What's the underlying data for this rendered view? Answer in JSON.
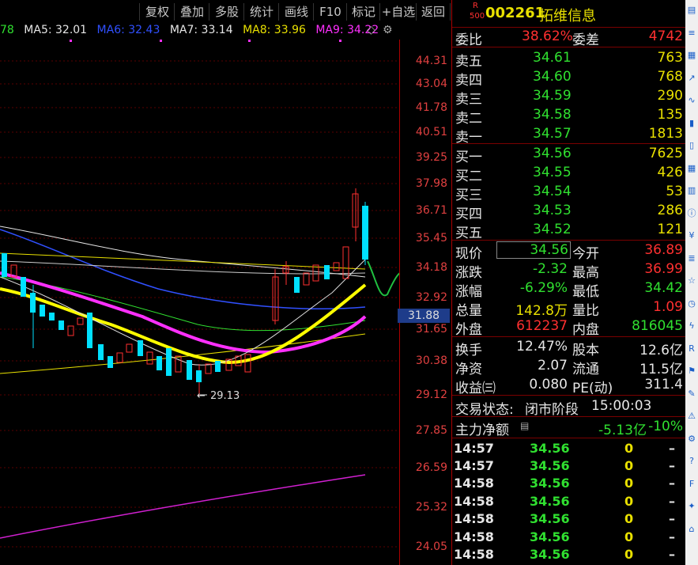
{
  "toolbar": {
    "buttons": [
      "复权",
      "叠加",
      "多股",
      "统计",
      "画线",
      "F10",
      "标记",
      "+自选",
      "返回"
    ]
  },
  "ma_legend": [
    {
      "label": "78",
      "color": "#30e030"
    },
    {
      "label": "MA5: 32.01",
      "color": "#e6e6e6"
    },
    {
      "label": "MA6: 32.43",
      "color": "#3050ff"
    },
    {
      "label": "MA7: 33.14",
      "color": "#e6e6e6"
    },
    {
      "label": "MA8: 33.96",
      "color": "#e8e000"
    },
    {
      "label": "MA9: 34.22",
      "color": "#ff30ff"
    }
  ],
  "y_axis": [
    "44.31",
    "43.04",
    "41.78",
    "40.51",
    "39.25",
    "37.98",
    "36.71",
    "35.45",
    "34.18",
    "32.92",
    "31.65",
    "30.38",
    "29.12",
    "27.85",
    "26.59",
    "25.32",
    "24.05"
  ],
  "current_price_tag": "31.88",
  "low_marker": "29.13",
  "stock": {
    "badge_top": "R",
    "badge_bottom": "500",
    "code": "002261",
    "name": "拓维信息"
  },
  "weibi": {
    "label": "委比",
    "value": "38.62%",
    "label2": "委差",
    "value2": "4742"
  },
  "sell": [
    {
      "label": "卖五",
      "price": "34.61",
      "vol": "763"
    },
    {
      "label": "卖四",
      "price": "34.60",
      "vol": "768"
    },
    {
      "label": "卖三",
      "price": "34.59",
      "vol": "290"
    },
    {
      "label": "卖二",
      "price": "34.58",
      "vol": "135"
    },
    {
      "label": "卖一",
      "price": "34.57",
      "vol": "1813"
    }
  ],
  "buy": [
    {
      "label": "买一",
      "price": "34.56",
      "vol": "7625"
    },
    {
      "label": "买二",
      "price": "34.55",
      "vol": "426"
    },
    {
      "label": "买三",
      "price": "34.54",
      "vol": "53"
    },
    {
      "label": "买四",
      "price": "34.53",
      "vol": "286"
    },
    {
      "label": "买五",
      "price": "34.52",
      "vol": "121"
    }
  ],
  "quote": [
    {
      "l1": "现价",
      "v1": "34.56",
      "l2": "今开",
      "v2": "36.89"
    },
    {
      "l1": "涨跌",
      "v1": "-2.32",
      "l2": "最高",
      "v2": "36.99"
    },
    {
      "l1": "涨幅",
      "v1": "-6.29%",
      "l2": "最低",
      "v2": "34.42"
    },
    {
      "l1": "总量",
      "v1": "142.8万",
      "l2": "量比",
      "v2": "1.09"
    },
    {
      "l1": "外盘",
      "v1": "612237",
      "l2": "内盘",
      "v2": "816045"
    }
  ],
  "stats": [
    {
      "l1": "换手",
      "v1": "12.47%",
      "l2": "股本",
      "v2": "12.6亿"
    },
    {
      "l1": "净资",
      "v1": "2.07",
      "l2": "流通",
      "v2": "11.5亿"
    },
    {
      "l1": "收益㈢",
      "v1": "0.080",
      "l2": "PE(动)",
      "v2": "311.4"
    }
  ],
  "trade_status": {
    "label": "交易状态:",
    "value": "闭市阶段",
    "time": "15:00:03"
  },
  "main_flow": {
    "label": "主力净额",
    "value": "-5.13亿",
    "pct": "-10%"
  },
  "ticks": [
    {
      "time": "14:57",
      "price": "34.56",
      "vol": "0",
      "flag": "–"
    },
    {
      "time": "14:57",
      "price": "34.56",
      "vol": "0",
      "flag": "–"
    },
    {
      "time": "14:58",
      "price": "34.56",
      "vol": "0",
      "flag": "–"
    },
    {
      "time": "14:58",
      "price": "34.56",
      "vol": "0",
      "flag": "–"
    },
    {
      "time": "14:58",
      "price": "34.56",
      "vol": "0",
      "flag": "–"
    },
    {
      "time": "14:58",
      "price": "34.56",
      "vol": "0",
      "flag": "–"
    },
    {
      "time": "14:58",
      "price": "34.56",
      "vol": "0",
      "flag": "–"
    }
  ],
  "sidebar_icons": [
    "menu-icon",
    "list-icon",
    "grid-icon",
    "chart-icon",
    "line-icon",
    "candle-icon",
    "bar-icon",
    "table-icon",
    "volume-icon",
    "info-icon",
    "money-icon",
    "news-icon",
    "star-icon",
    "clock-icon",
    "lightning-icon",
    "compare-icon",
    "flag-icon",
    "filter-icon",
    "alert-icon",
    "settings-icon",
    "help-icon",
    "user-icon",
    "tool-icon",
    "home-icon"
  ],
  "sidebar_glyphs": [
    "▤",
    "≡",
    "▦",
    "↗",
    "∿",
    "▮",
    "▯",
    "▦",
    "▥",
    "ⓘ",
    "¥",
    "≣",
    "☆",
    "◷",
    "ϟ",
    "R",
    "⚑",
    "✎",
    "⚠",
    "⚙",
    "?",
    "F",
    "✦",
    "⌂"
  ]
}
